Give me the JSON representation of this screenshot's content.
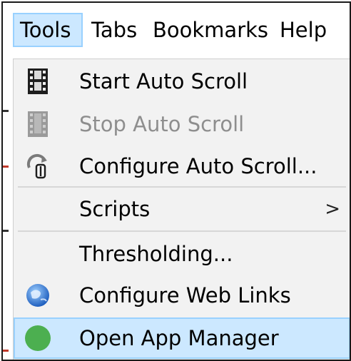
{
  "menubar": {
    "items": [
      {
        "label": "Tools",
        "active": true
      },
      {
        "label": "Tabs"
      },
      {
        "label": "Bookmarks"
      },
      {
        "label": "Help"
      }
    ]
  },
  "dropdown": {
    "items": [
      {
        "label": "Start Auto Scroll",
        "icon": "film-strip-icon",
        "enabled": true
      },
      {
        "label": "Stop Auto Scroll",
        "icon": "film-strip-disabled-icon",
        "enabled": false
      },
      {
        "label": "Configure Auto Scroll...",
        "icon": "scroll-config-icon",
        "enabled": true
      },
      {
        "label": "Scripts",
        "submenu_arrow": ">"
      },
      {
        "label": "Thresholding..."
      },
      {
        "label": "Configure Web Links",
        "icon": "globe-icon"
      },
      {
        "label": "Open App Manager",
        "icon": "green-circle-icon",
        "highlighted": true
      }
    ]
  },
  "colors": {
    "highlight_bg": "#cce8ff",
    "highlight_border": "#99d1ff",
    "menu_bg": "#f2f2f2",
    "disabled_text": "#8e8e8e",
    "green_icon": "#4caf50"
  }
}
